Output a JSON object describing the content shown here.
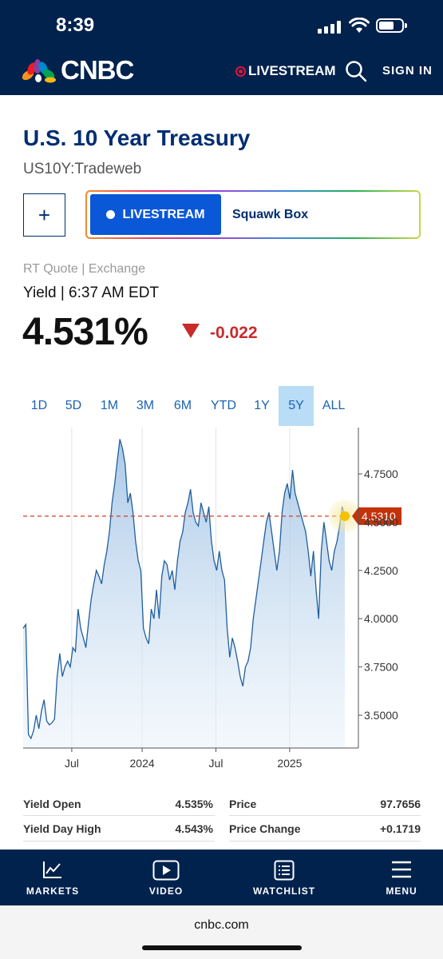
{
  "status": {
    "time": "8:39"
  },
  "header": {
    "logo_text": "CNBC",
    "livestream": "LIVESTREAM",
    "signin": "SIGN IN"
  },
  "quote": {
    "title": "U.S. 10 Year Treasury",
    "symbol": "US10Y:Tradeweb",
    "add_label": "+",
    "live_button": "LIVESTREAM",
    "live_show": "Squawk Box",
    "rt_quote": "RT Quote | Exchange",
    "yield_time": "Yield | 6:37 AM EDT",
    "price": "4.531%",
    "change": "-0.022"
  },
  "ranges": [
    "1D",
    "5D",
    "1M",
    "3M",
    "6M",
    "YTD",
    "1Y",
    "5Y",
    "ALL"
  ],
  "active_range": "5Y",
  "colors": {
    "brand": "#00224d",
    "title": "#002d72",
    "down": "#c92a2a",
    "link": "#1a63b0",
    "marker": "#f2c200",
    "last_price_tag": "#c4320a"
  },
  "chart_data": {
    "type": "area",
    "current_label": "4.5310",
    "current_value": 4.531,
    "x_ticks": [
      "Jul",
      "2024",
      "Jul",
      "2025"
    ],
    "y_ticks": [
      "4.7500",
      "4.5000",
      "4.2500",
      "4.0000",
      "3.7500",
      "3.5000"
    ],
    "ylim": [
      3.33,
      4.99
    ],
    "x_range": [
      0,
      100
    ],
    "x_tick_positions": [
      14.5,
      35.5,
      57.5,
      79.5
    ],
    "values": [
      3.95,
      3.97,
      3.4,
      3.38,
      3.42,
      3.5,
      3.43,
      3.52,
      3.58,
      3.47,
      3.45,
      3.46,
      3.48,
      3.7,
      3.82,
      3.7,
      3.75,
      3.78,
      3.75,
      3.85,
      3.83,
      4.05,
      3.95,
      3.9,
      3.85,
      3.98,
      4.1,
      4.18,
      4.25,
      4.22,
      4.18,
      4.28,
      4.35,
      4.45,
      4.6,
      4.7,
      4.82,
      4.93,
      4.88,
      4.8,
      4.6,
      4.65,
      4.55,
      4.4,
      4.3,
      4.25,
      3.95,
      3.9,
      3.87,
      4.05,
      4.0,
      4.15,
      4.0,
      4.22,
      4.3,
      4.28,
      4.2,
      4.25,
      4.15,
      4.3,
      4.4,
      4.45,
      4.55,
      4.6,
      4.67,
      4.55,
      4.5,
      4.48,
      4.6,
      4.55,
      4.5,
      4.58,
      4.4,
      4.3,
      4.25,
      4.35,
      4.25,
      4.2,
      3.95,
      3.8,
      3.9,
      3.85,
      3.78,
      3.7,
      3.65,
      3.75,
      3.78,
      3.85,
      4.0,
      4.1,
      4.2,
      4.3,
      4.4,
      4.5,
      4.55,
      4.45,
      4.35,
      4.25,
      4.35,
      4.55,
      4.65,
      4.7,
      4.62,
      4.77,
      4.65,
      4.6,
      4.55,
      4.5,
      4.45,
      4.35,
      4.22,
      4.35,
      4.15,
      4.0,
      4.35,
      4.5,
      4.4,
      4.3,
      4.25,
      4.35,
      4.4,
      4.48,
      4.58,
      4.53
    ]
  },
  "stats": [
    {
      "label": "Yield Open",
      "value": "4.535%",
      "label2": "Price",
      "value2": "97.7656"
    },
    {
      "label": "Yield Day High",
      "value": "4.543%",
      "label2": "Price Change",
      "value2": "+0.1719"
    }
  ],
  "bottom_nav": [
    {
      "label": "MARKETS",
      "icon": "chart-line-icon"
    },
    {
      "label": "VIDEO",
      "icon": "play-icon"
    },
    {
      "label": "WATCHLIST",
      "icon": "list-icon"
    },
    {
      "label": "MENU",
      "icon": "menu-icon"
    }
  ],
  "browser": {
    "url": "cnbc.com"
  }
}
